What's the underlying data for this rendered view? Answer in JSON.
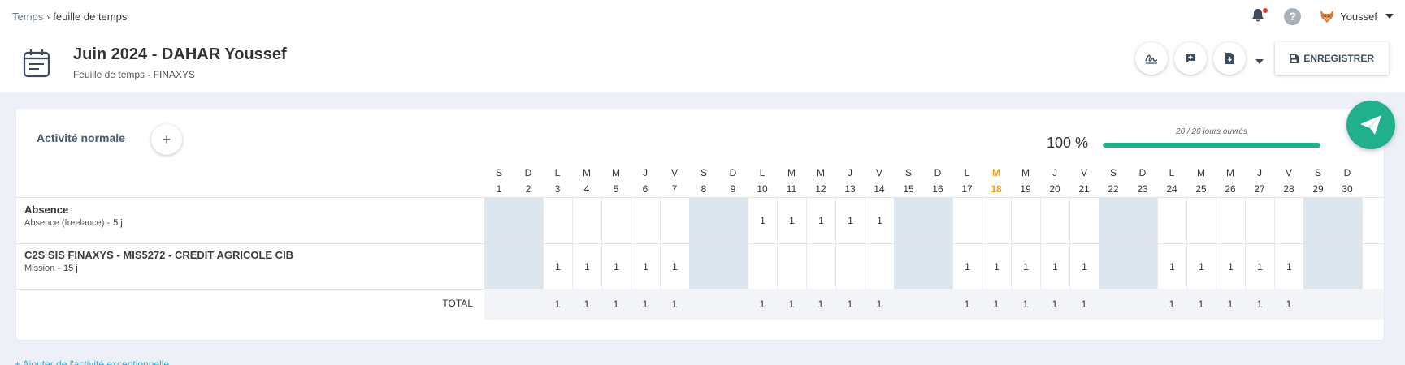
{
  "breadcrumb": {
    "parent": "Temps",
    "current": "feuille de temps"
  },
  "user": {
    "name": "Youssef"
  },
  "header": {
    "title": "Juin 2024 - DAHAR Youssef",
    "subtitle": "Feuille de temps - FINAXYS"
  },
  "actions": {
    "save_label": "ENREGISTRER"
  },
  "section": {
    "title": "Activité normale",
    "add_label": "+"
  },
  "progress": {
    "percent_label": "100 %",
    "label": "20 / 20 jours ouvrés",
    "value": 1.0
  },
  "days": [
    {
      "l": "S",
      "n": "1",
      "w": true
    },
    {
      "l": "D",
      "n": "2",
      "w": true
    },
    {
      "l": "L",
      "n": "3"
    },
    {
      "l": "M",
      "n": "4"
    },
    {
      "l": "M",
      "n": "5"
    },
    {
      "l": "J",
      "n": "6"
    },
    {
      "l": "V",
      "n": "7"
    },
    {
      "l": "S",
      "n": "8",
      "w": true
    },
    {
      "l": "D",
      "n": "9",
      "w": true
    },
    {
      "l": "L",
      "n": "10"
    },
    {
      "l": "M",
      "n": "11"
    },
    {
      "l": "M",
      "n": "12"
    },
    {
      "l": "J",
      "n": "13"
    },
    {
      "l": "V",
      "n": "14"
    },
    {
      "l": "S",
      "n": "15",
      "w": true
    },
    {
      "l": "D",
      "n": "16",
      "w": true
    },
    {
      "l": "L",
      "n": "17"
    },
    {
      "l": "M",
      "n": "18",
      "today": true
    },
    {
      "l": "M",
      "n": "19"
    },
    {
      "l": "J",
      "n": "20"
    },
    {
      "l": "V",
      "n": "21"
    },
    {
      "l": "S",
      "n": "22",
      "w": true
    },
    {
      "l": "D",
      "n": "23",
      "w": true
    },
    {
      "l": "L",
      "n": "24"
    },
    {
      "l": "M",
      "n": "25"
    },
    {
      "l": "M",
      "n": "26"
    },
    {
      "l": "J",
      "n": "27"
    },
    {
      "l": "V",
      "n": "28"
    },
    {
      "l": "S",
      "n": "29",
      "w": true
    },
    {
      "l": "D",
      "n": "30",
      "w": true
    }
  ],
  "rows": [
    {
      "title": "Absence",
      "type_label": "Absence (freelance) -",
      "count": "5 j",
      "values": [
        "",
        "",
        "",
        "",
        "",
        "",
        "",
        "",
        "",
        "1",
        "1",
        "1",
        "1",
        "1",
        "",
        "",
        "",
        "",
        "",
        "",
        "",
        "",
        "",
        "",
        "",
        "",
        "",
        "",
        "",
        ""
      ]
    },
    {
      "title": "C2S SIS FINAXYS - MIS5272 - CREDIT AGRICOLE CIB",
      "type_label": "Mission -",
      "count": "15 j",
      "values": [
        "",
        "",
        "1",
        "1",
        "1",
        "1",
        "1",
        "",
        "",
        "",
        "",
        "",
        "",
        "",
        "",
        "",
        "1",
        "1",
        "1",
        "1",
        "1",
        "",
        "",
        "1",
        "1",
        "1",
        "1",
        "1",
        "",
        ""
      ]
    }
  ],
  "total": {
    "label": "TOTAL",
    "values": [
      "",
      "",
      "1",
      "1",
      "1",
      "1",
      "1",
      "",
      "",
      "1",
      "1",
      "1",
      "1",
      "1",
      "",
      "",
      "1",
      "1",
      "1",
      "1",
      "1",
      "",
      "",
      "1",
      "1",
      "1",
      "1",
      "1",
      "",
      ""
    ]
  },
  "footer": {
    "link_label": "+ Ajouter de l'activité exceptionnelle"
  },
  "colors": {
    "accent": "#21b08c",
    "today": "#f39c12",
    "weekend": "#dde5ee"
  }
}
